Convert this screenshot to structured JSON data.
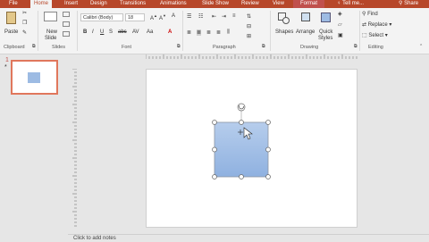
{
  "tabs": [
    "File",
    "Home",
    "Insert",
    "Design",
    "Transitions",
    "Animations",
    "Slide Show",
    "Review",
    "View",
    "Format"
  ],
  "tell_me": "Tell me...",
  "share": "Share",
  "clipboard": {
    "paste": "Paste",
    "group": "Clipboard"
  },
  "slides": {
    "new_slide_line1": "New",
    "new_slide_line2": "Slide",
    "group": "Slides"
  },
  "font": {
    "name": "Calibri (Body)",
    "size": "18",
    "group": "Font",
    "bold": "B",
    "italic": "I",
    "underline": "U",
    "strike": "S",
    "font_color": "A"
  },
  "paragraph": {
    "group": "Paragraph"
  },
  "drawing": {
    "shapes": "Shapes",
    "arrange": "Arrange",
    "quick_styles_line1": "Quick",
    "quick_styles_line2": "Styles",
    "group": "Drawing"
  },
  "editing": {
    "find": "Find",
    "replace": "Replace",
    "select": "Select",
    "group": "Editing"
  },
  "thumbnail": {
    "number": "1",
    "star": "*"
  },
  "notes_placeholder": "Click to add notes",
  "colors": {
    "accent": "#b7472a",
    "shape_fill": "#9dbbe3"
  }
}
